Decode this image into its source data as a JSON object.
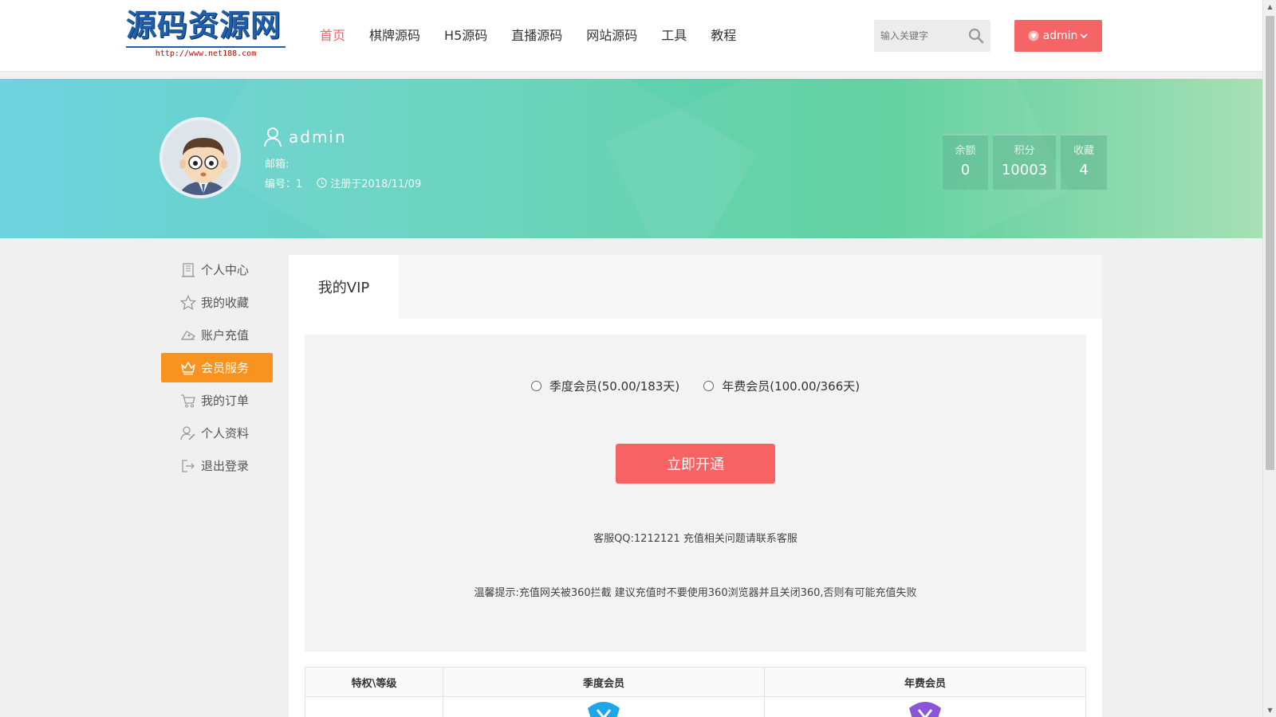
{
  "header": {
    "logo": {
      "main": "源码资源网",
      "url": "http://www.net188.com"
    },
    "nav": [
      "首页",
      "棋牌源码",
      "H5源码",
      "直播源码",
      "网站源码",
      "工具",
      "教程"
    ],
    "active_nav": "首页",
    "search": {
      "placeholder": "输入关键字",
      "icon": "search-icon"
    },
    "user_button": "admin",
    "accent_color": "#f56565"
  },
  "profile": {
    "username": "admin",
    "email_label": "邮箱:",
    "id_label": "编号：1",
    "register": "注册于2018/11/09",
    "stats": [
      {
        "label": "余额",
        "value": "0"
      },
      {
        "label": "积分",
        "value": "10003"
      },
      {
        "label": "收藏",
        "value": "4"
      }
    ]
  },
  "sidebar": {
    "items": [
      {
        "label": "个人中心",
        "icon": "building-icon"
      },
      {
        "label": "我的收藏",
        "icon": "star-icon"
      },
      {
        "label": "账户充值",
        "icon": "wallet-icon"
      },
      {
        "label": "会员服务",
        "icon": "crown-icon",
        "active": true
      },
      {
        "label": "我的订单",
        "icon": "cart-icon"
      },
      {
        "label": "个人资料",
        "icon": "user-edit-icon"
      },
      {
        "label": "退出登录",
        "icon": "logout-icon"
      }
    ],
    "active_color": "#f7931e"
  },
  "main": {
    "tab": "我的VIP",
    "options": [
      "季度会员(50.00/183天)",
      "年费会员(100.00/366天)"
    ],
    "open_button": "立即开通",
    "qq_text": "客服QQ:1212121 充值相关问题请联系客服",
    "tip_text": "温馨提示:充值网关被360拦截 建议充值时不要使用360浏览器并且关闭360,否则有可能充值失败",
    "table": {
      "headers": [
        "特权\\等级",
        "季度会员",
        "年费会员"
      ]
    }
  }
}
